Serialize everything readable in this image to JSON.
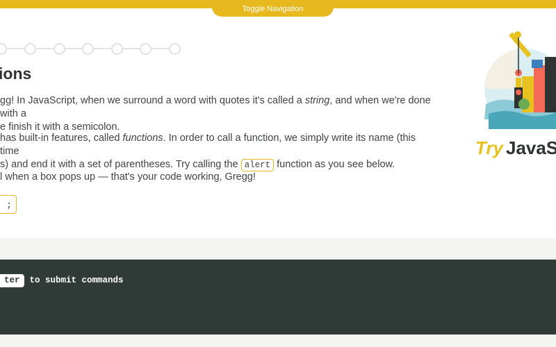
{
  "nav": {
    "toggle_label": "Toggle Navigation"
  },
  "lesson": {
    "title": "ions",
    "p1_a": "gg! In JavaScript, when we surround a word with quotes it's called a ",
    "p1_em": "string",
    "p1_b": ", and when we're done with a",
    "p1_c": "e finish it with a semicolon.",
    "p2_a": " has built-in features, called ",
    "p2_em": "functions",
    "p2_b": ". In order to call a function, we simply write its name (this time",
    "p2_c": "s) and end it with a set of parentheses. Try calling the ",
    "p2_code": "alert",
    "p2_d": " function as you see below.",
    "p3": "l when a box pops up — that's your code working, Gregg!",
    "code_snippet": ";"
  },
  "console": {
    "key_label": "ter",
    "hint": "to submit commands"
  },
  "logo": {
    "try": "Try",
    "name": "JavaSc"
  },
  "colors": {
    "accent": "#e8b81f",
    "console_bg": "#303b38"
  }
}
